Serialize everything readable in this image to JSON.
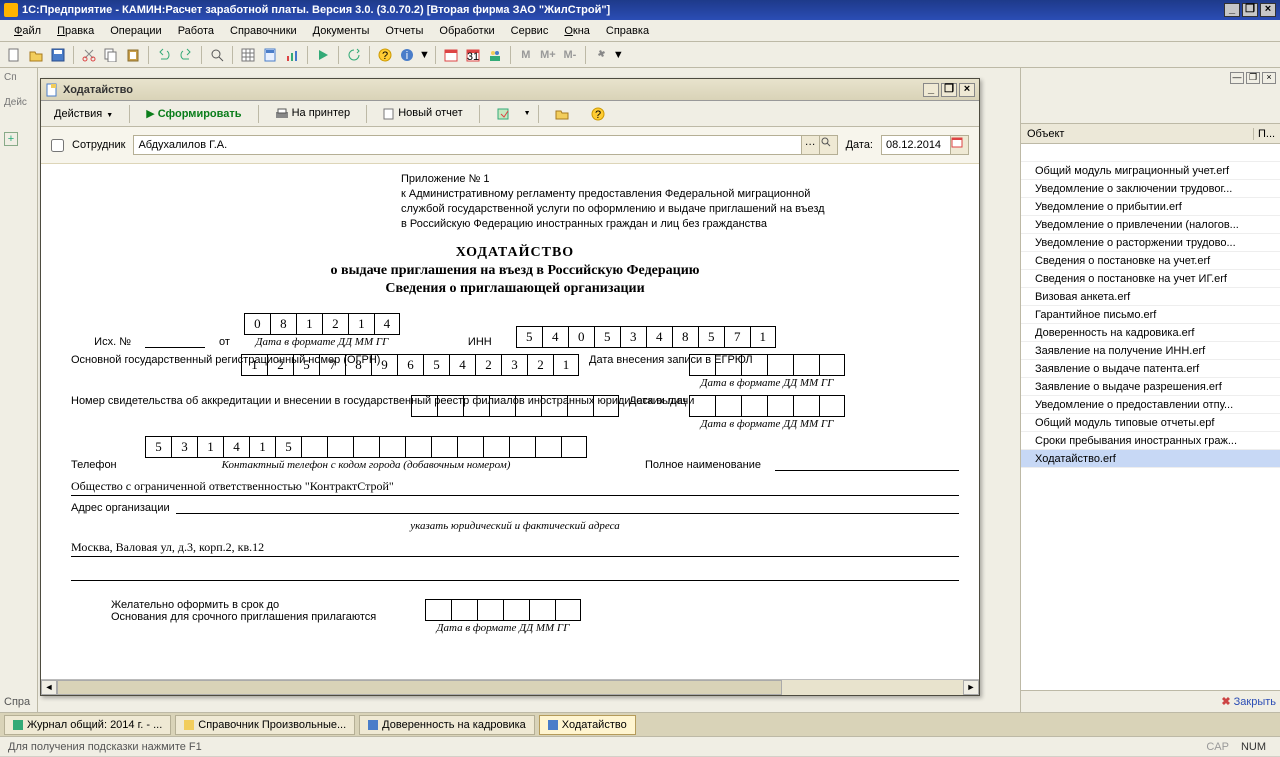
{
  "app": {
    "title": "1С:Предприятие - КАМИН:Расчет заработной платы. Версия 3.0. (3.0.70.2) [Вторая фирма ЗАО \"ЖилСтрой\"]"
  },
  "menubar": [
    "Файл",
    "Правка",
    "Операции",
    "Работа",
    "Справочники",
    "Документы",
    "Отчеты",
    "Обработки",
    "Сервис",
    "Окна",
    "Справка"
  ],
  "leftpanel": {
    "top": "Сп",
    "action": "Дейс",
    "bottom": "Спра"
  },
  "subwindow": {
    "title": "Ходатайство",
    "toolbar": {
      "actions": "Действия",
      "form": "Сформировать",
      "print": "На принтер",
      "new": "Новый отчет"
    },
    "form": {
      "employee_lbl": "Сотрудник",
      "employee_val": "Абдухалилов Г.А.",
      "date_lbl": "Дата:",
      "date_val": "08.12.2014"
    },
    "doc": {
      "preamble": [
        "Приложение № 1",
        "к Административному регламенту предоставления Федеральной миграционной",
        "службой государственной услуги по оформлению и выдаче приглашений на въезд",
        "в Российскую Федерацию иностранных граждан и лиц без гражданства"
      ],
      "h2": "ХОДАТАЙСТВО",
      "h3": "о выдаче приглашения на въезд в Российскую Федерацию",
      "h4": "Сведения о приглашающей организации",
      "ish": "Исх. №",
      "ot": "от",
      "date_cells": [
        "0",
        "8",
        "1",
        "2",
        "1",
        "4"
      ],
      "date_fmt": "Дата в формате ДД ММ ГГ",
      "inn_lbl": "ИНН",
      "inn": [
        "5",
        "4",
        "0",
        "5",
        "3",
        "4",
        "8",
        "5",
        "7",
        "1"
      ],
      "ogrn_lbl": "Основной государственный регистрационный номер (ОГРН)",
      "ogrn": [
        "1",
        "2",
        "5",
        "7",
        "8",
        "9",
        "6",
        "5",
        "4",
        "2",
        "3",
        "2",
        "1"
      ],
      "egrul_lbl": "Дата внесения записи в ЕГРЮЛ",
      "accred_lbl": "Номер свидетельства об аккредитации и внесении в государственный реестр филиалов иностранных юридических лиц",
      "issue_lbl": "Дата выдачи",
      "phone_lbl": "Телефон",
      "phone": [
        "5",
        "3",
        "1",
        "4",
        "1",
        "5"
      ],
      "phone_hint": "Контактный телефон с кодом города (добавочным номером)",
      "fullname_lbl": "Полное наименование",
      "fullname_val": "Общество с ограниченной ответственностью \"КонтрактСтрой\"",
      "addr_lbl": "Адрес организации",
      "addr_hint": "указать  юридический и фактический адреса",
      "addr_val": "Москва, Валовая ул, д.3, корп.2, кв.12",
      "wish_lbl": "Желательно оформить в срок до",
      "wish_hint": "Основания для срочного приглашения прилагаются"
    }
  },
  "rightpanel": {
    "col1": "Объект",
    "col2": "П...",
    "rows": [
      "Общий модуль миграционный учет.erf",
      "Уведомление о заключении трудовог...",
      "Уведомление о прибытии.erf",
      "Уведомление о привлечении (налогов...",
      "Уведомление о расторжении трудово...",
      "Сведения о постановке на учет.erf",
      "Сведения о постановке на учет ИГ.erf",
      "Визовая анкета.erf",
      "Гарантийное письмо.erf",
      "Доверенность на кадровика.erf",
      "Заявление на получение ИНН.erf",
      "Заявление о выдаче патента.erf",
      "Заявление о выдаче разрешения.erf",
      "Уведомление о предоставлении отпу...",
      "Общий модуль типовые отчеты.epf",
      "Сроки пребывания иностранных граж...",
      "Ходатайство.erf"
    ],
    "close": "Закрыть"
  },
  "taskbar": [
    "Журнал общий: 2014 г. - ...",
    "Справочник Произвольные...",
    "Доверенность на кадровика",
    "Ходатайство"
  ],
  "statusbar": {
    "hint": "Для получения подсказки нажмите F1",
    "cap": "CAP",
    "num": "NUM"
  }
}
